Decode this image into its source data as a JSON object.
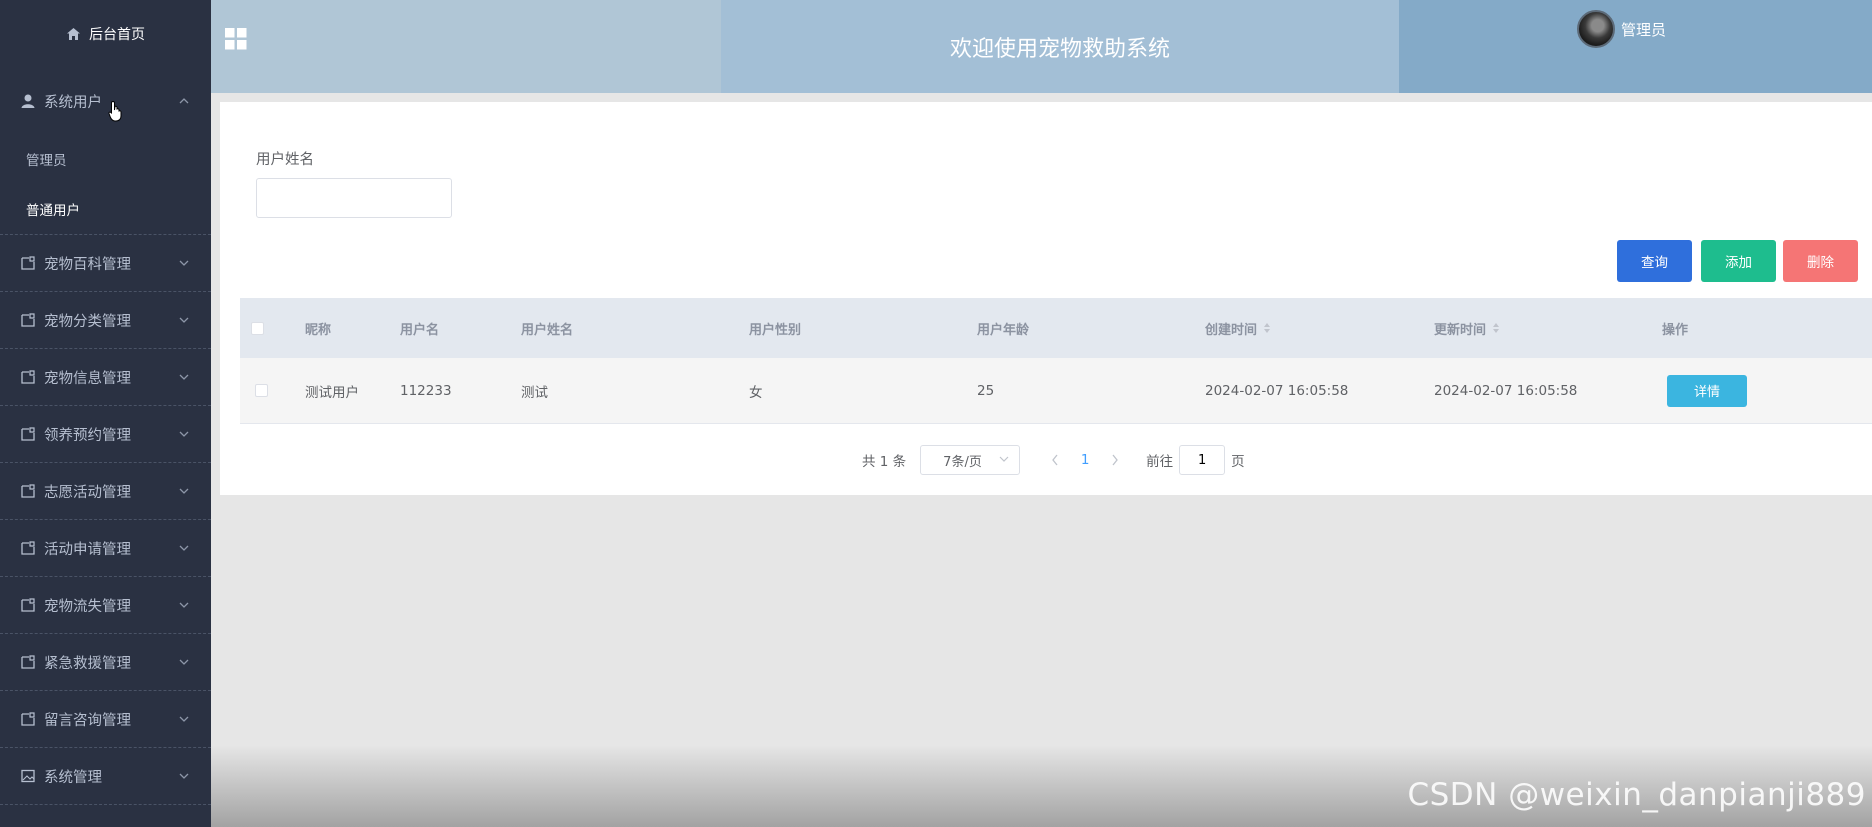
{
  "sidebar": {
    "home": "后台首页",
    "items": [
      {
        "label": "系统用户",
        "open": true
      },
      {
        "label": "宠物百科管理"
      },
      {
        "label": "宠物分类管理"
      },
      {
        "label": "宠物信息管理"
      },
      {
        "label": "领养预约管理"
      },
      {
        "label": "志愿活动管理"
      },
      {
        "label": "活动申请管理"
      },
      {
        "label": "宠物流失管理"
      },
      {
        "label": "紧急救援管理"
      },
      {
        "label": "留言咨询管理"
      },
      {
        "label": "系统管理"
      }
    ],
    "sub_items": [
      "管理员",
      "普通用户"
    ]
  },
  "header": {
    "title": "欢迎使用宠物救助系统",
    "user": "管理员"
  },
  "search": {
    "label": "用户姓名",
    "value": "",
    "placeholder": ""
  },
  "toolbar": {
    "query_label": "查询",
    "add_label": "添加",
    "delete_label": "删除"
  },
  "table": {
    "columns": [
      "昵称",
      "用户名",
      "用户姓名",
      "用户性别",
      "用户年龄",
      "创建时间",
      "更新时间",
      "操作"
    ],
    "rows": [
      {
        "nickname": "测试用户",
        "username": "112233",
        "realname": "测试",
        "gender": "女",
        "age": "25",
        "created": "2024-02-07 16:05:58",
        "updated": "2024-02-07 16:05:58",
        "action": "详情"
      }
    ]
  },
  "pagination": {
    "total": "共 1 条",
    "page_size": "7条/页",
    "current_page": "1",
    "goto_prefix": "前往",
    "goto_value": "1",
    "goto_suffix": "页"
  },
  "watermark": "CSDN @weixin_danpianji889",
  "colors": {
    "sidebar_bg": "#2a3142",
    "query": "#2f6fdc",
    "add": "#1ebd8e",
    "delete": "#f57575",
    "detail": "#3bb5e0"
  }
}
